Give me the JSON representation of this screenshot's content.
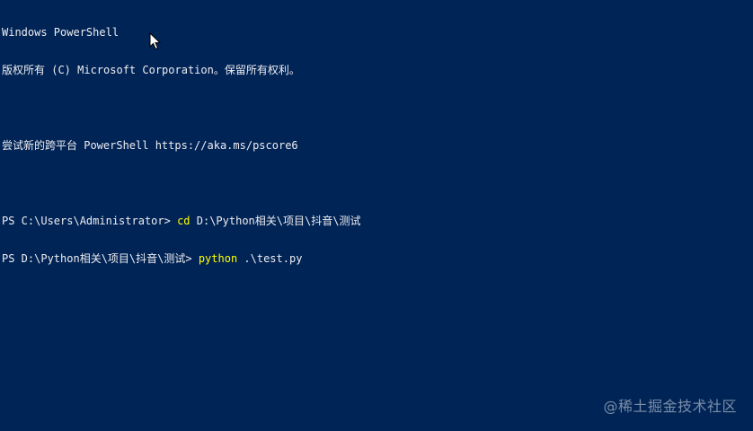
{
  "console": {
    "header_line1": "Windows PowerShell",
    "header_line2": "版权所有 (C) Microsoft Corporation。保留所有权利。",
    "promo_line": "尝试新的跨平台 PowerShell https://aka.ms/pscore6",
    "prompt1": "PS C:\\Users\\Administrator> ",
    "command1_keyword": "cd",
    "command1_args": " D:\\Python相关\\项目\\抖音\\测试",
    "prompt2": "PS D:\\Python相关\\项目\\抖音\\测试> ",
    "command2_keyword": "python",
    "command2_args": " .\\test.py"
  },
  "watermark": "@稀土掘金技术社区",
  "colors": {
    "background": "#012456",
    "text": "#eeedf0",
    "command": "#ffff00"
  },
  "icons": {
    "mouse_cursor": "arrow-cursor-icon"
  }
}
